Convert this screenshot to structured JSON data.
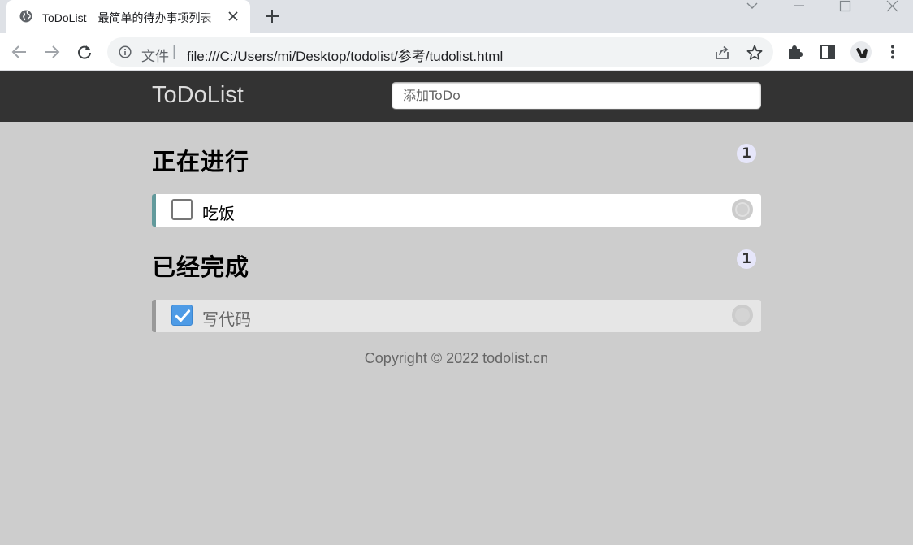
{
  "browser": {
    "tab_title": "ToDoList—最简单的待办事项列表",
    "omnibox": {
      "file_label": "文件",
      "separator": "|",
      "url": "file:///C:/Users/mi/Desktop/todolist/参考/tudolist.html"
    }
  },
  "app": {
    "title": "ToDoList",
    "input_placeholder": "添加ToDo",
    "sections": {
      "doing": {
        "title": "正在进行",
        "count": "1",
        "items": [
          {
            "text": "吃饭",
            "done": false
          }
        ]
      },
      "done": {
        "title": "已经完成",
        "count": "1",
        "items": [
          {
            "text": "写代码",
            "done": true
          }
        ]
      }
    },
    "footer": "Copyright © 2022 todolist.cn"
  },
  "colors": {
    "header_bg": "#333333",
    "page_bg": "#cdcdcd",
    "doing_accent": "#629a9c",
    "checkbox_checked": "#4e9be6",
    "badge_bg": "#e6e6fa"
  }
}
